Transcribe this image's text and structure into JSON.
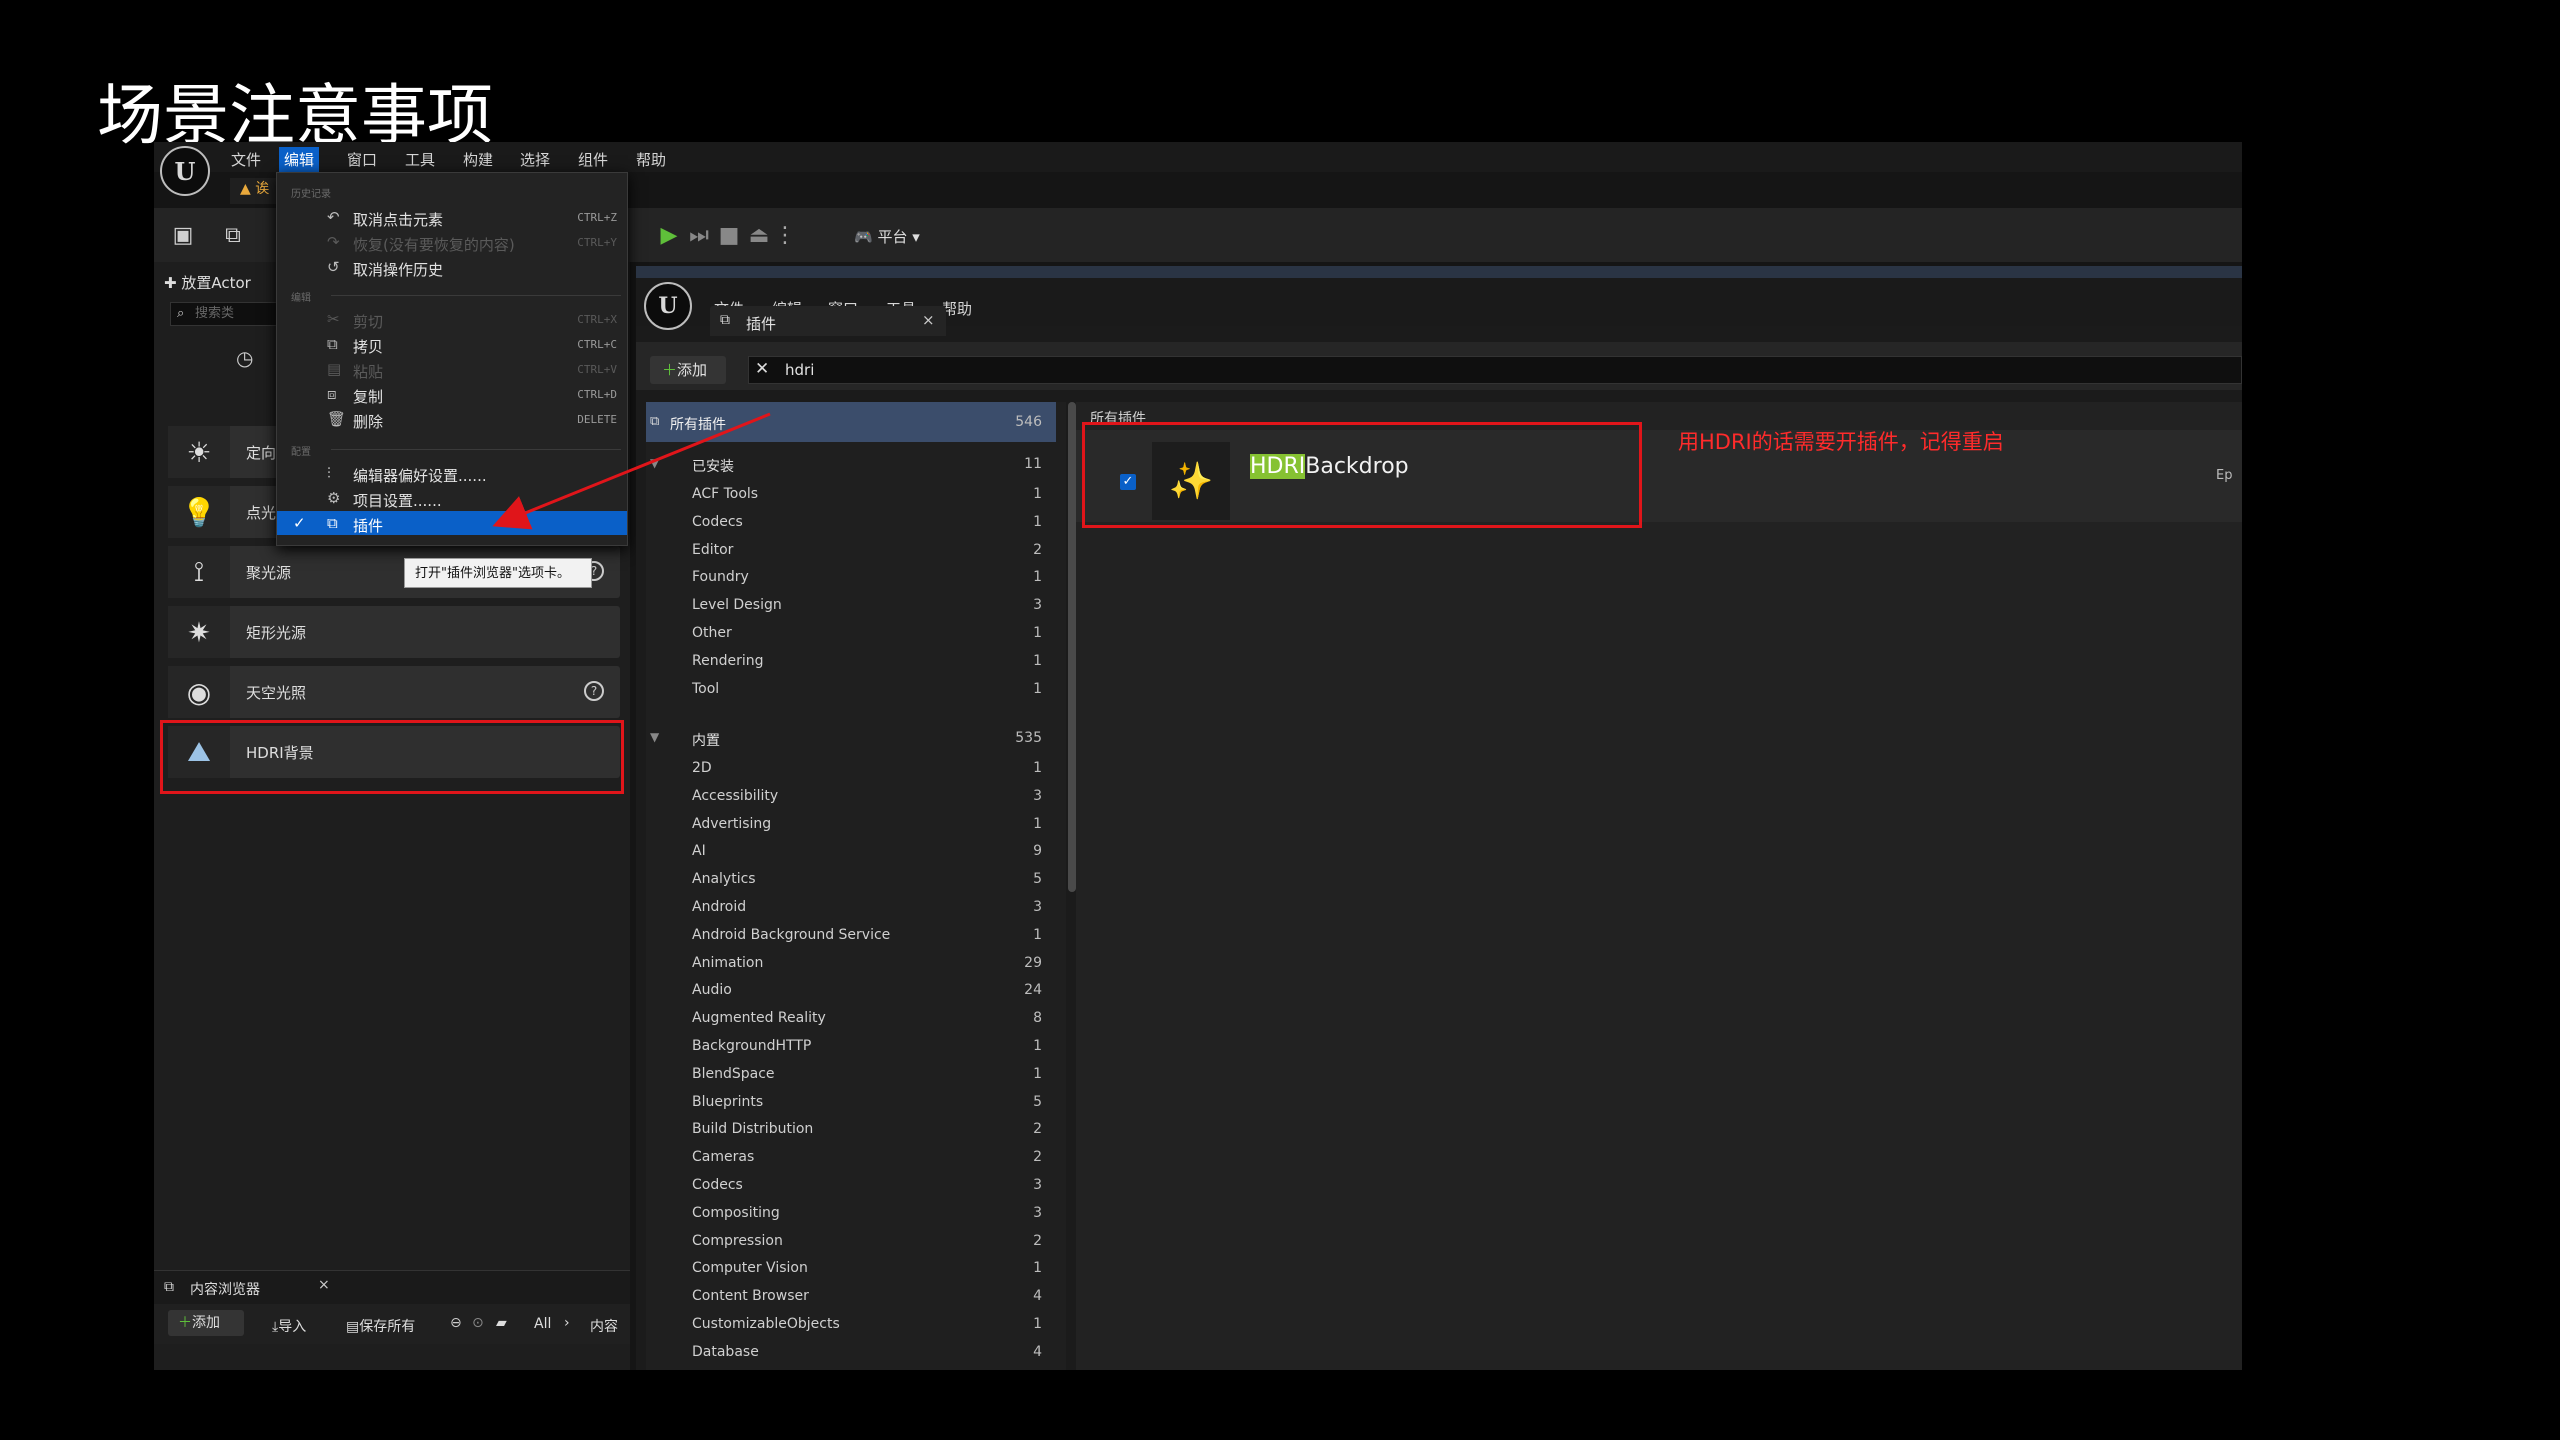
{
  "slide_title": "场景注意事项",
  "main_menu": [
    "文件",
    "编辑",
    "窗口",
    "工具",
    "构建",
    "选择",
    "组件",
    "帮助"
  ],
  "main_menu_active": "编辑",
  "warn_text": "诶",
  "place_actor": {
    "tab_label": "放置Actor",
    "search_placeholder": "搜索类",
    "rows": [
      {
        "label": "定向光源",
        "icon": "sun-icon"
      },
      {
        "label": "点光源",
        "icon": "bulb-icon"
      },
      {
        "label": "聚光源",
        "icon": "spotlight-icon"
      },
      {
        "label": "矩形光源",
        "icon": "rect-light-icon"
      },
      {
        "label": "天空光照",
        "icon": "skylight-icon"
      },
      {
        "label": "HDRI背景",
        "icon": "hdri-icon"
      }
    ]
  },
  "dropdown": {
    "sec1": "历史记录",
    "undo": {
      "label": "取消点击元素",
      "shortcut": "CTRL+Z"
    },
    "redo": {
      "label": "恢复(没有要恢复的内容)",
      "shortcut": "CTRL+Y"
    },
    "undo_history": {
      "label": "取消操作历史"
    },
    "sec2": "编辑",
    "cut": {
      "label": "剪切",
      "shortcut": "CTRL+X"
    },
    "copy": {
      "label": "拷贝",
      "shortcut": "CTRL+C"
    },
    "paste": {
      "label": "粘贴",
      "shortcut": "CTRL+V"
    },
    "duplicate": {
      "label": "复制",
      "shortcut": "CTRL+D"
    },
    "delete": {
      "label": "删除",
      "shortcut": "DELETE"
    },
    "sec3": "配置",
    "editor_prefs": {
      "label": "编辑器偏好设置......"
    },
    "project_settings": {
      "label": "项目设置......"
    },
    "plugins": {
      "label": "插件"
    }
  },
  "tooltip": "打开\"插件浏览器\"选项卡。",
  "content_browser": {
    "tab": "内容浏览器",
    "add": "添加",
    "import": "导入",
    "save_all": "保存所有",
    "path_all": "All",
    "path_content": "内容"
  },
  "main_toolbar": {
    "platform": "平台"
  },
  "plugin_window": {
    "menu": [
      "文件",
      "编辑",
      "窗口",
      "工具",
      "帮助"
    ],
    "tab": "插件",
    "add": "添加",
    "search_value": "hdri",
    "all_plugins": {
      "label": "所有插件",
      "count": "546"
    },
    "installed": {
      "label": "已安装",
      "count": "11"
    },
    "installed_items": [
      {
        "name": "ACF Tools",
        "count": "1"
      },
      {
        "name": "Codecs",
        "count": "1"
      },
      {
        "name": "Editor",
        "count": "2"
      },
      {
        "name": "Foundry",
        "count": "1"
      },
      {
        "name": "Level Design",
        "count": "3"
      },
      {
        "name": "Other",
        "count": "1"
      },
      {
        "name": "Rendering",
        "count": "1"
      },
      {
        "name": "Tool",
        "count": "1"
      }
    ],
    "builtin": {
      "label": "内置",
      "count": "535"
    },
    "builtin_items": [
      {
        "name": "2D",
        "count": "1"
      },
      {
        "name": "Accessibility",
        "count": "3"
      },
      {
        "name": "Advertising",
        "count": "1"
      },
      {
        "name": "AI",
        "count": "9"
      },
      {
        "name": "Analytics",
        "count": "5"
      },
      {
        "name": "Android",
        "count": "3"
      },
      {
        "name": "Android Background Service",
        "count": "1"
      },
      {
        "name": "Animation",
        "count": "29"
      },
      {
        "name": "Audio",
        "count": "24"
      },
      {
        "name": "Augmented Reality",
        "count": "8"
      },
      {
        "name": "BackgroundHTTP",
        "count": "1"
      },
      {
        "name": "BlendSpace",
        "count": "1"
      },
      {
        "name": "Blueprints",
        "count": "5"
      },
      {
        "name": "Build Distribution",
        "count": "2"
      },
      {
        "name": "Cameras",
        "count": "2"
      },
      {
        "name": "Codecs",
        "count": "3"
      },
      {
        "name": "Compositing",
        "count": "3"
      },
      {
        "name": "Compression",
        "count": "2"
      },
      {
        "name": "Computer Vision",
        "count": "1"
      },
      {
        "name": "Content Browser",
        "count": "4"
      },
      {
        "name": "CustomizableObjects",
        "count": "1"
      },
      {
        "name": "Database",
        "count": "4"
      }
    ],
    "results_header": "所有插件",
    "plugin_name_hl": "HDRI",
    "plugin_name_rest": "Backdrop",
    "plugin_author_clip": "Ep"
  },
  "annotation": "用HDRI的话需要开插件，记得重启",
  "colors": {
    "accent": "#0a60c8",
    "highlight": "#e0151a",
    "match": "#86c232"
  }
}
